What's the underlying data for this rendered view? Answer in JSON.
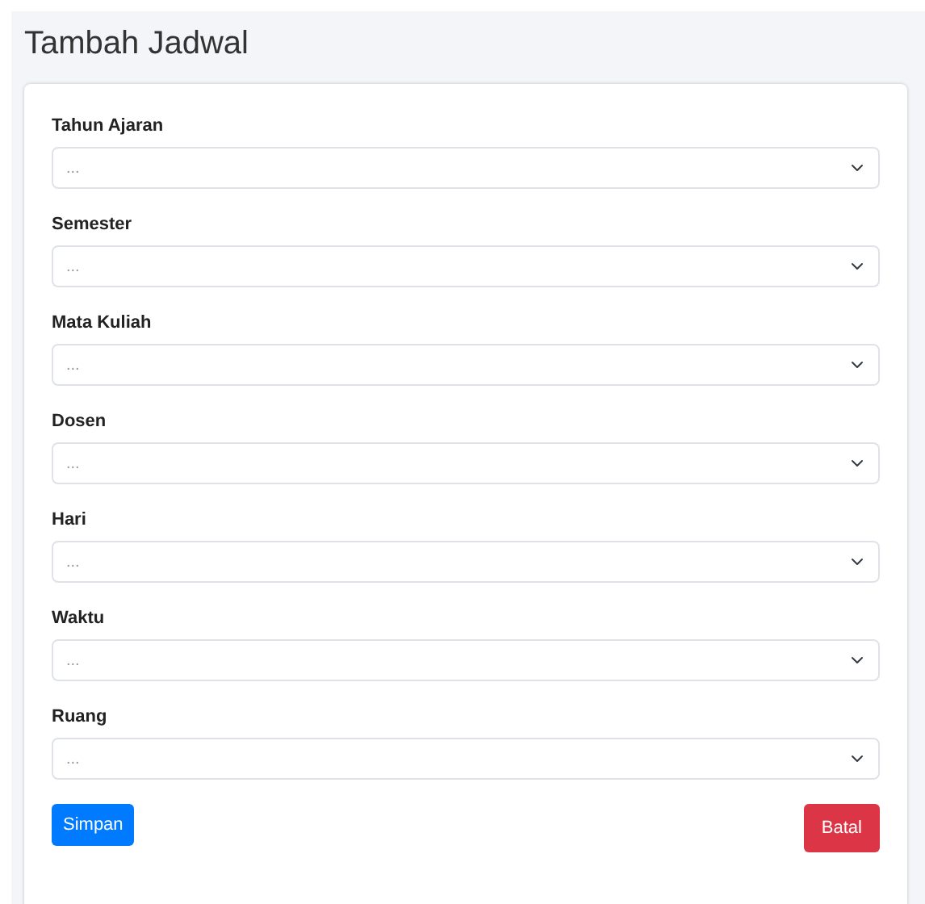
{
  "page": {
    "title": "Tambah Jadwal"
  },
  "fields": [
    {
      "label": "Tahun Ajaran",
      "placeholder": "..."
    },
    {
      "label": "Semester",
      "placeholder": "..."
    },
    {
      "label": "Mata Kuliah",
      "placeholder": "..."
    },
    {
      "label": "Dosen",
      "placeholder": "..."
    },
    {
      "label": "Hari",
      "placeholder": "..."
    },
    {
      "label": "Waktu",
      "placeholder": "..."
    },
    {
      "label": "Ruang",
      "placeholder": "..."
    }
  ],
  "buttons": [
    {
      "label": "Simpan",
      "kind": "primary"
    },
    {
      "label": "Batal",
      "kind": "danger"
    }
  ]
}
